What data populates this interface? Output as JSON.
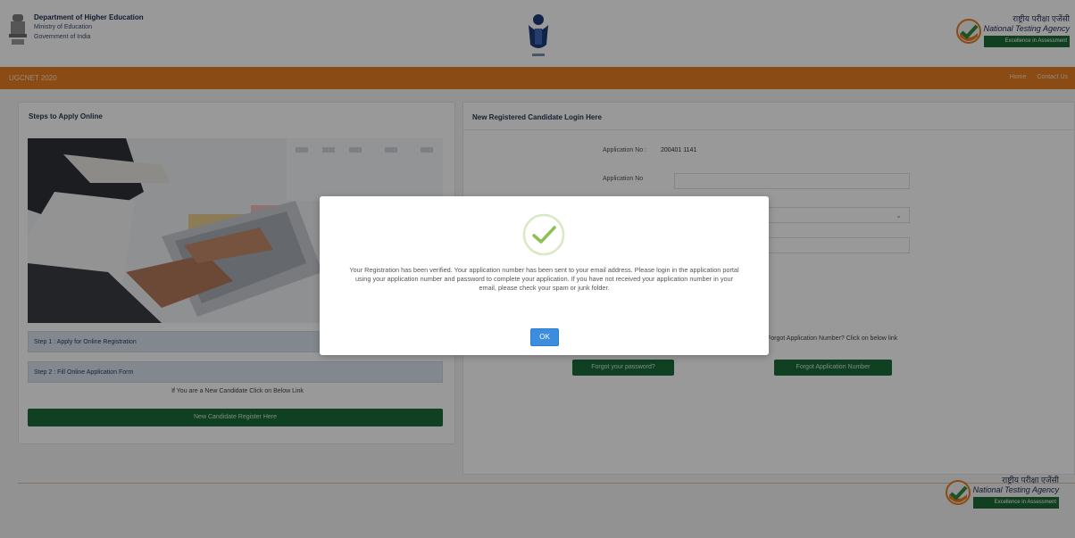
{
  "header": {
    "dept_line1": "Department of Higher Education",
    "dept_line2": "Ministry of Education",
    "dept_line3": "Government of India",
    "nta_hindi": "राष्ट्रीय परीक्षा एजेंसी",
    "nta_english": "National Testing Agency",
    "nta_tagline": "Excellence in Assessment"
  },
  "nav": {
    "title": "UGCNET 2020",
    "links": [
      "Home",
      "Contact Us"
    ]
  },
  "left_panel": {
    "title": "Steps to Apply Online",
    "steps": [
      "Step 1 : Apply for Online Registration",
      "Step 2 : Fill Online Application Form"
    ],
    "new_candidate_text": "If You are a New Candidate Click on Below Link",
    "new_registration_button": "New Candidate Register Here"
  },
  "right_panel": {
    "title": "New Registered Candidate Login Here",
    "application_no_label": "Application No :",
    "application_no_value": "200401 1141",
    "application_no_field_label": "Application No",
    "forgot_note": "Forgot Application Number? Click on below link",
    "forgot_password_button": "Forgot your password?",
    "forgot_appno_button": "Forgot Application Number"
  },
  "modal": {
    "message": "Your Registration has been verified. Your application number has been sent to your email address. Please login in the application portal using your application number and password to complete your application. If you have not received your application number in your email, please check your spam or junk folder.",
    "ok_label": "OK"
  },
  "colors": {
    "orange": "#e67e22",
    "green_button": "#1a6c39",
    "ok_blue": "#3c8dde",
    "check_green": "#8cc152"
  }
}
